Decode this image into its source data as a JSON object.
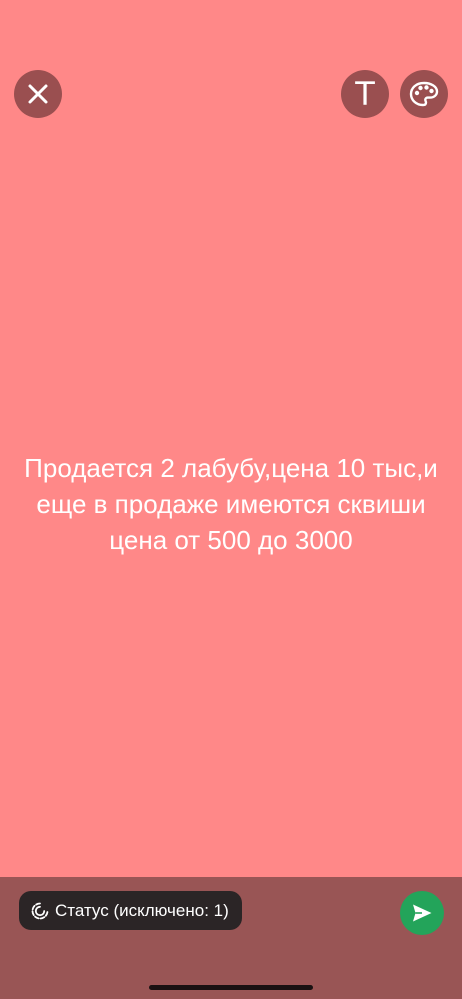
{
  "toolbar": {
    "close_icon": "close-icon",
    "text_button_glyph": "T",
    "palette_icon": "palette-icon"
  },
  "status": {
    "text": "Продается 2 лабубу,цена 10 тыс,и еще в продаже имеются сквиши цена от 500 до 3000",
    "background_color": "#FF8888",
    "text_color": "#FFFFFF"
  },
  "composer": {
    "privacy_label": "Статус (исключено: 1)",
    "privacy_icon": "status-ring-icon",
    "send_icon": "send-icon",
    "send_color": "#23A45A"
  }
}
